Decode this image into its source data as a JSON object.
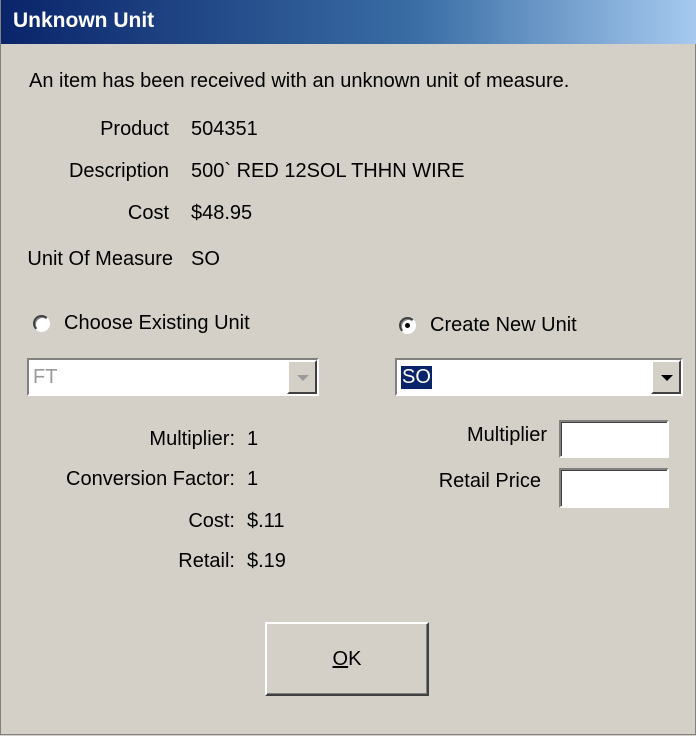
{
  "dialog": {
    "title": "Unknown Unit",
    "intro": "An item has been received with an unknown unit of measure."
  },
  "item": {
    "product_label": "Product",
    "product_value": "504351",
    "description_label": "Description",
    "description_value": "500` RED 12SOL THHN WIRE",
    "cost_label": "Cost",
    "cost_value": "$48.95",
    "uom_label": "Unit Of Measure",
    "uom_value": "SO"
  },
  "existing": {
    "radio_label": "Choose Existing Unit",
    "selected": false,
    "combo_value": "FT",
    "multiplier_label": "Multiplier:",
    "multiplier_value": "1",
    "conversion_label": "Conversion Factor:",
    "conversion_value": "1",
    "cost_label": "Cost:",
    "cost_value": "$.11",
    "retail_label": "Retail:",
    "retail_value": "$.19"
  },
  "create": {
    "radio_label": "Create New Unit",
    "selected": true,
    "combo_value": "SO",
    "multiplier_label": "Multiplier",
    "multiplier_value": "",
    "retail_label": "Retail Price",
    "retail_value": ""
  },
  "buttons": {
    "ok_mnemonic": "O",
    "ok_rest": "K"
  }
}
